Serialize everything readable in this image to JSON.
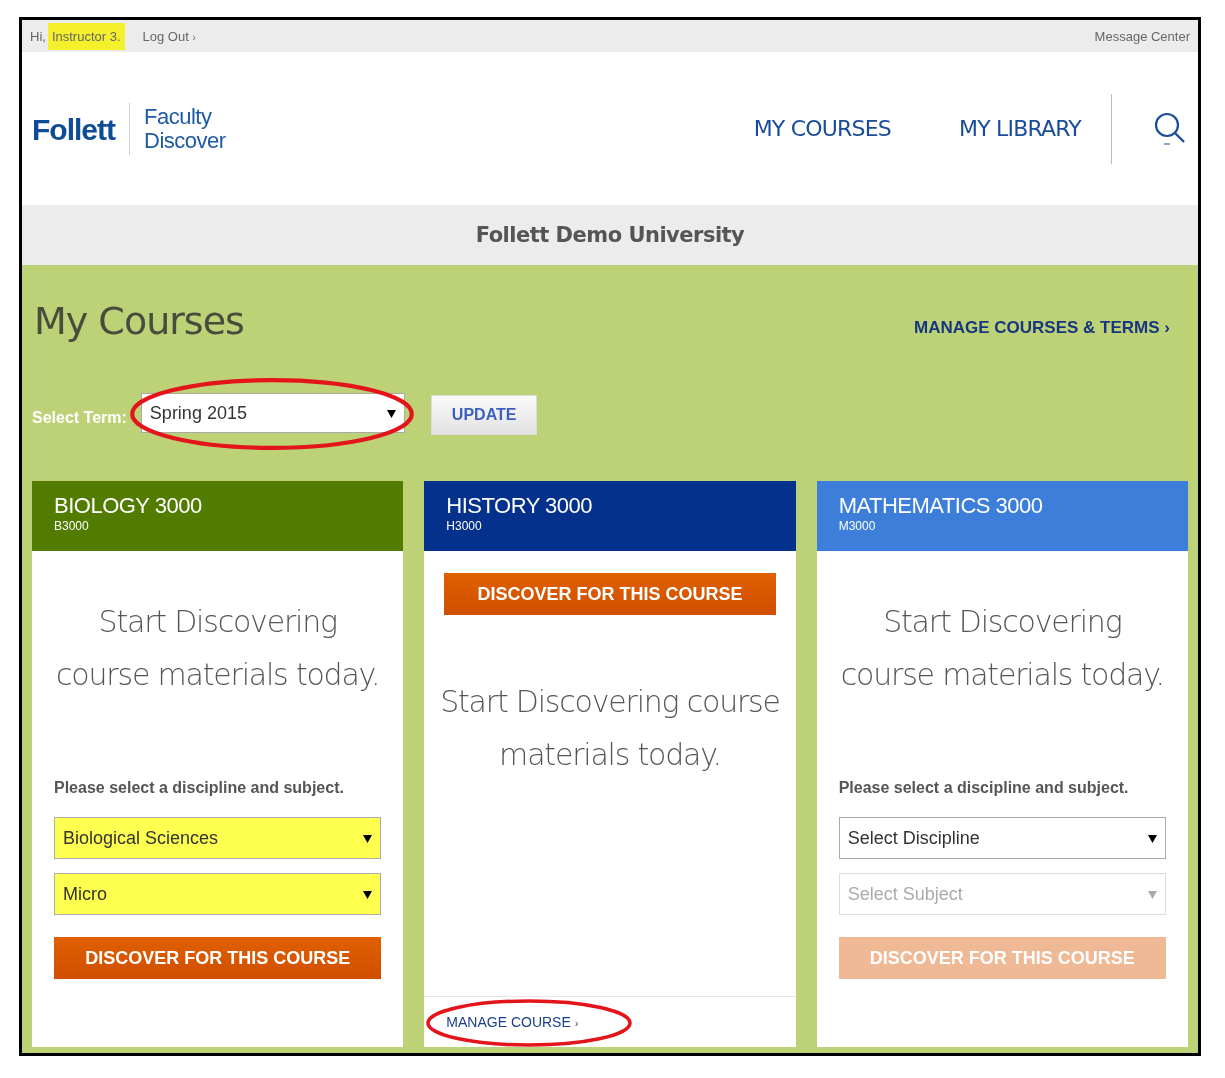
{
  "top_bar": {
    "greeting": "Hi,",
    "user_name": "Instructor 3.",
    "user_highlighted": true,
    "logout": "Log Out",
    "logout_caret": "›",
    "message_center": "Message Center"
  },
  "header": {
    "logo": "Follett",
    "product_line1": "Faculty",
    "product_line2": "Discover",
    "nav": [
      "MY COURSES",
      "MY LIBRARY"
    ]
  },
  "institution": "Follett Demo University",
  "page": {
    "title": "My Courses",
    "manage_link": "MANAGE COURSES & TERMS",
    "manage_caret": "›",
    "term_label": "Select Term:",
    "term_value": "Spring 2015",
    "term_circled": true,
    "update_button": "UPDATE"
  },
  "courses": [
    {
      "kind": "select",
      "title": "BIOLOGY 3000",
      "code": "B3000",
      "color": "#517c00",
      "message": "Start Discovering course materials today.",
      "prompt": "Please select a discipline and subject.",
      "fields": [
        {
          "value": "Biological Sciences",
          "highlighted": true,
          "disabled": false
        },
        {
          "value": "Micro",
          "highlighted": true,
          "disabled": false
        }
      ],
      "discover_button": "DISCOVER FOR THIS COURSE",
      "discover_disabled": false
    },
    {
      "kind": "managed",
      "title": "HISTORY 3000",
      "code": "H3000",
      "color": "#04318c",
      "message": "Start Discovering course materials today.",
      "discover_button": "DISCOVER FOR THIS COURSE",
      "discover_disabled": false,
      "manage_link": "MANAGE COURSE",
      "manage_caret": "›",
      "manage_circled": true
    },
    {
      "kind": "select",
      "title": "MATHEMATICS 3000",
      "code": "M3000",
      "color": "#3d7edb",
      "message": "Start Discovering course materials today.",
      "prompt": "Please select a discipline and subject.",
      "fields": [
        {
          "placeholder": "Select Discipline",
          "highlighted": false,
          "disabled": false
        },
        {
          "placeholder": "Select Subject",
          "highlighted": false,
          "disabled": true
        }
      ],
      "discover_button": "DISCOVER FOR THIS COURSE",
      "discover_disabled": true
    }
  ]
}
